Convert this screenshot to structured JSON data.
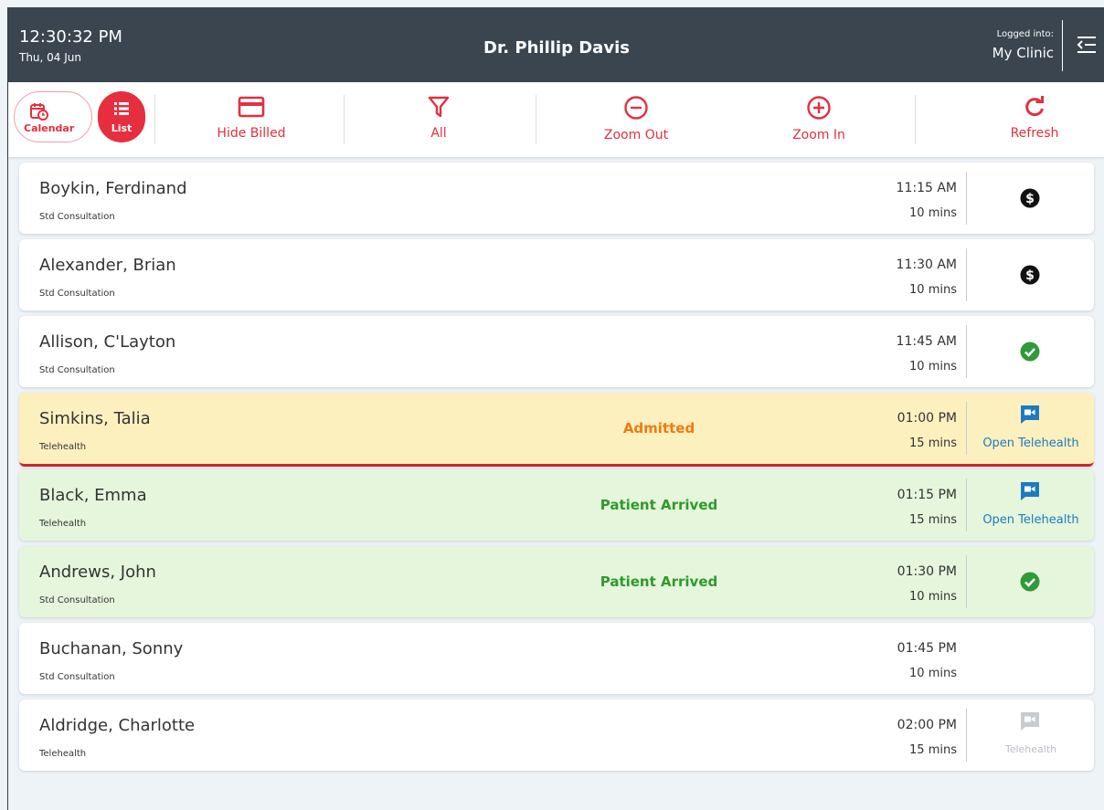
{
  "header": {
    "time": "12:30:32 PM",
    "date": "Thu, 04 Jun",
    "doctor": "Dr. Phillip Davis",
    "logged_label": "Logged into:",
    "clinic": "My Clinic"
  },
  "toolbar": {
    "calendar_label": "Calendar",
    "list_label": "List",
    "hide_billed_label": "Hide Billed",
    "filter_label": "All",
    "zoom_out_label": "Zoom Out",
    "zoom_in_label": "Zoom In",
    "refresh_label": "Refresh",
    "accent_color": "#e3303f"
  },
  "appointments": [
    {
      "name": "Boykin, Ferdinand",
      "type": "Std Consultation",
      "status": "",
      "time": "11:15 AM",
      "duration": "10 mins",
      "action": "billed-icon"
    },
    {
      "name": "Alexander, Brian",
      "type": "Std Consultation",
      "status": "",
      "time": "11:30 AM",
      "duration": "10 mins",
      "action": "billed-icon"
    },
    {
      "name": "Allison, C'Layton",
      "type": "Std Consultation",
      "status": "",
      "time": "11:45 AM",
      "duration": "10 mins",
      "action": "check-icon"
    },
    {
      "name": "Simkins, Talia",
      "type": "Telehealth",
      "status": "Admitted",
      "time": "01:00 PM",
      "duration": "15 mins",
      "action": "telehealth",
      "action_label": "Open Telehealth"
    },
    {
      "name": "Black, Emma",
      "type": "Telehealth",
      "status": "Patient Arrived",
      "time": "01:15 PM",
      "duration": "15 mins",
      "action": "telehealth",
      "action_label": "Open Telehealth"
    },
    {
      "name": "Andrews, John",
      "type": "Std Consultation",
      "status": "Patient Arrived",
      "time": "01:30 PM",
      "duration": "10 mins",
      "action": "check-icon"
    },
    {
      "name": "Buchanan, Sonny",
      "type": "Std Consultation",
      "status": "",
      "time": "01:45 PM",
      "duration": "10 mins",
      "action": ""
    },
    {
      "name": "Aldridge, Charlotte",
      "type": "Telehealth",
      "status": "",
      "time": "02:00 PM",
      "duration": "15 mins",
      "action": "telehealth-disabled",
      "action_label": "Telehealth"
    }
  ]
}
